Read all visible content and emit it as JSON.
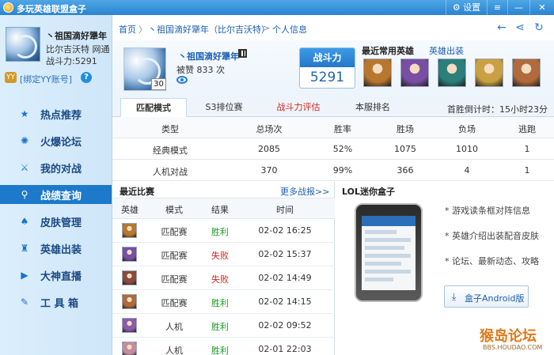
{
  "titlebar": {
    "app_title": "多玩英雄联盟盒子",
    "settings_label": "设置",
    "menu_icon": "menu-icon",
    "minimize_icon": "minimize-icon",
    "close_icon": "close-icon"
  },
  "sidebar": {
    "name": "丶祖国滴好犟年",
    "server": "比尔吉沃特 网通",
    "power": "战斗力:5291",
    "bind_yy": "[绑定YY账号]",
    "help": "?",
    "items": [
      {
        "icon": "star-icon",
        "glyph": "★",
        "label": "热点推荐"
      },
      {
        "icon": "flame-icon",
        "glyph": "✺",
        "label": "火爆论坛"
      },
      {
        "icon": "battle-icon",
        "glyph": "⚔",
        "label": "我的对战"
      },
      {
        "icon": "search-icon",
        "glyph": "⚲",
        "label": "战绩查询"
      },
      {
        "icon": "skin-icon",
        "glyph": "♠",
        "label": "皮肤管理"
      },
      {
        "icon": "equip-icon",
        "glyph": "♜",
        "label": "英雄出装"
      },
      {
        "icon": "play-icon",
        "glyph": "▶",
        "label": "大神直播"
      },
      {
        "icon": "toolbox-icon",
        "glyph": "✎",
        "label": "工 具 箱"
      }
    ],
    "active_index": 3
  },
  "breadcrumb": {
    "home": "首页",
    "sep": "丶",
    "player": "祖国滴好犟年（比尔吉沃特）",
    "arrow": ">",
    "page": "个人信息"
  },
  "profile": {
    "level": "30",
    "name": "丶祖国滴好犟年",
    "likes": "被赞 833 次",
    "power_title": "战斗力",
    "power_value": "5291",
    "recent_heroes_title": "最近常用英雄",
    "hero_gear_link": "英雄出装",
    "hero_colors": [
      "#b8772f",
      "#7a4fa3",
      "#2c7f7a",
      "#caa142",
      "#b06a3c"
    ]
  },
  "tabs": {
    "items": [
      "匹配模式",
      "S3排位赛",
      "战斗力评估",
      "本服排名"
    ],
    "active_index": 0,
    "countdown": "首胜倒计时：15小时23分"
  },
  "stats": {
    "headers": [
      "类型",
      "总场次",
      "胜率",
      "胜场",
      "负场",
      "逃跑"
    ],
    "rows": [
      [
        "经典模式",
        "2085",
        "52%",
        "1075",
        "1010",
        "1"
      ],
      [
        "人机对战",
        "370",
        "99%",
        "366",
        "4",
        "1"
      ]
    ]
  },
  "recent_matches": {
    "title": "最近比赛",
    "more": "更多战报>>",
    "headers": [
      "英雄",
      "模式",
      "结果",
      "时间"
    ],
    "rows": [
      {
        "hero_color": "#b8772f",
        "mode": "匹配赛",
        "result": "胜利",
        "win": true,
        "time": "02-02 16:25"
      },
      {
        "hero_color": "#7a4fa3",
        "mode": "匹配赛",
        "result": "失败",
        "win": false,
        "time": "02-02 15:37"
      },
      {
        "hero_color": "#8a4b3a",
        "mode": "匹配赛",
        "result": "失败",
        "win": false,
        "time": "02-02 14:49"
      },
      {
        "hero_color": "#b06a3c",
        "mode": "匹配赛",
        "result": "胜利",
        "win": true,
        "time": "02-02 14:15"
      },
      {
        "hero_color": "#8b5ba8",
        "mode": "人机",
        "result": "胜利",
        "win": true,
        "time": "02-02 09:52"
      },
      {
        "hero_color": "#c58ca0",
        "mode": "人机",
        "result": "胜利",
        "win": true,
        "time": "02-01 22:03"
      }
    ]
  },
  "mini_box": {
    "title": "LOL迷你盒子",
    "features": [
      "* 游戏读条框对阵信息",
      "* 英雄介绍出装配音皮肤",
      "* 论坛、最新动态、攻略"
    ],
    "download": "盒子Android版"
  },
  "watermark": {
    "main": "猴岛论坛",
    "sub": "BBS.HOUDAO.COM"
  }
}
